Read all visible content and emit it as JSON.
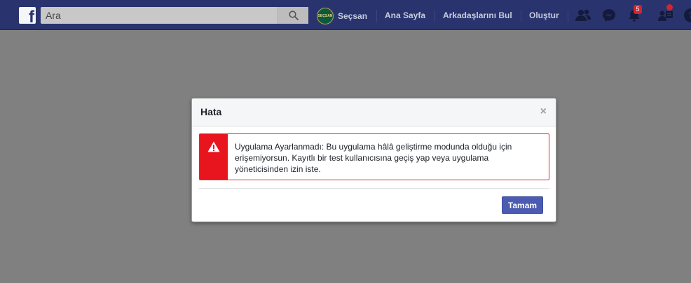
{
  "topbar": {
    "logo_letter": "f",
    "search": {
      "placeholder": "Ara"
    },
    "profile": {
      "name": "Seçsan",
      "avatar_text": "SEÇSAN"
    },
    "nav": {
      "home": "Ana Sayfa",
      "find_friends": "Arkadaşlarını Bul",
      "create": "Oluştur"
    },
    "notifications_count": "5",
    "icons": [
      "friend-requests-icon",
      "messenger-icon",
      "notifications-icon",
      "page-admin-icon",
      "help-icon"
    ]
  },
  "dialog": {
    "title": "Hata",
    "close_glyph": "×",
    "error_message": "Uygulama Ayarlanmadı: Bu uygulama hâlâ geliştirme modunda olduğu için erişemiyorsun. Kayıtlı bir test kullanıcısına geçiş yap veya uygulama yöneticisinden izin iste.",
    "ok_label": "Tamam"
  },
  "colors": {
    "topbar": "#29346e",
    "backdrop": "#808080",
    "error_red": "#e8151f",
    "button_blue": "#4b5bb2",
    "badge_red": "#d3252c"
  }
}
